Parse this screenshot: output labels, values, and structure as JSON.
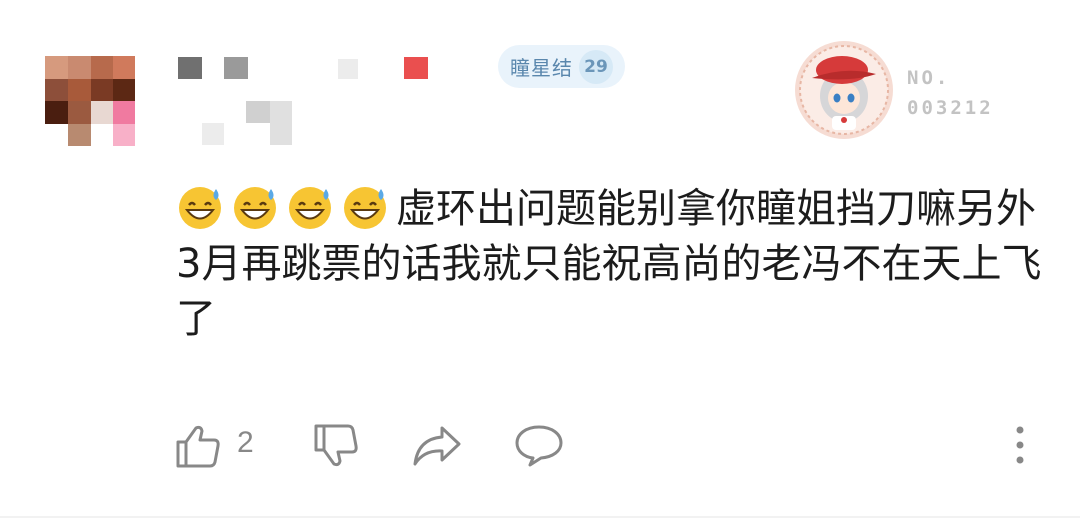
{
  "user": {
    "badge": {
      "name": "瞳星结",
      "level": "29",
      "color": "#5a87ad"
    },
    "avatar_frame": {
      "no_label": "NO.",
      "no_number": "003212"
    }
  },
  "comment": {
    "emoji_icons": [
      "grinning-sweat-emoji",
      "grinning-sweat-emoji",
      "grinning-sweat-emoji",
      "grinning-sweat-emoji"
    ],
    "text": "虚环出问题能别拿你瞳姐挡刀嘛另外3月再跳票的话我就只能祝高尚的老冯不在天上飞了"
  },
  "actions": {
    "like_count": "2",
    "icons": [
      "thumbs-up-icon",
      "thumbs-down-icon",
      "share-icon",
      "comment-icon",
      "more-icon"
    ]
  },
  "colors": {
    "icon_gray": "#888888",
    "text": "#1c1c1c",
    "badge_bg": "#e9f3fb"
  }
}
